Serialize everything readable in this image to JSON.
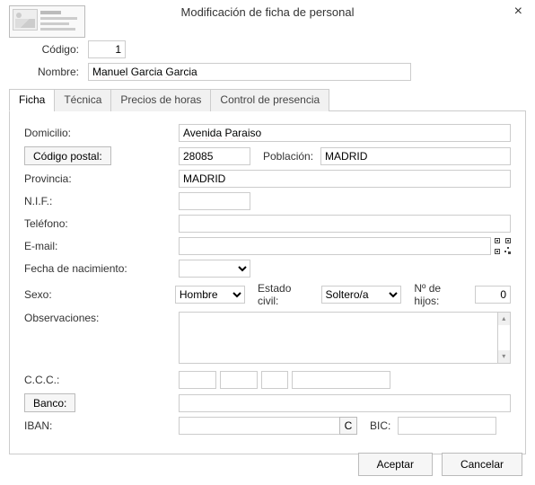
{
  "dialog": {
    "title": "Modificación de ficha de personal"
  },
  "header": {
    "codigo_label": "Código:",
    "codigo_value": "1",
    "nombre_label": "Nombre:",
    "nombre_value": "Manuel Garcia Garcia"
  },
  "tabs": {
    "t0": "Ficha",
    "t1": "Técnica",
    "t2": "Precios de horas",
    "t3": "Control de presencia"
  },
  "fields": {
    "domicilio_label": "Domicilio:",
    "domicilio_value": "Avenida Paraiso",
    "cp_button": "Código postal:",
    "cp_value": "28085",
    "poblacion_label": "Población:",
    "poblacion_value": "MADRID",
    "provincia_label": "Provincia:",
    "provincia_value": "MADRID",
    "nif_label": "N.I.F.:",
    "nif_value": "",
    "tel_label": "Teléfono:",
    "tel_value": "",
    "email_label": "E-mail:",
    "email_value": "",
    "nac_label": "Fecha de nacimiento:",
    "nac_value": "",
    "sexo_label": "Sexo:",
    "sexo_value": "Hombre",
    "civil_label": "Estado civil:",
    "civil_value": "Soltero/a",
    "hijos_label": "Nº de hijos:",
    "hijos_value": "0",
    "obs_label": "Observaciones:",
    "obs_value": "",
    "ccc_label": "C.C.C.:",
    "banco_button": "Banco:",
    "banco_value": "",
    "iban_label": "IBAN:",
    "iban_value": "",
    "iban_c": "C",
    "bic_label": "BIC:",
    "bic_value": ""
  },
  "buttons": {
    "ok": "Aceptar",
    "cancel": "Cancelar"
  }
}
